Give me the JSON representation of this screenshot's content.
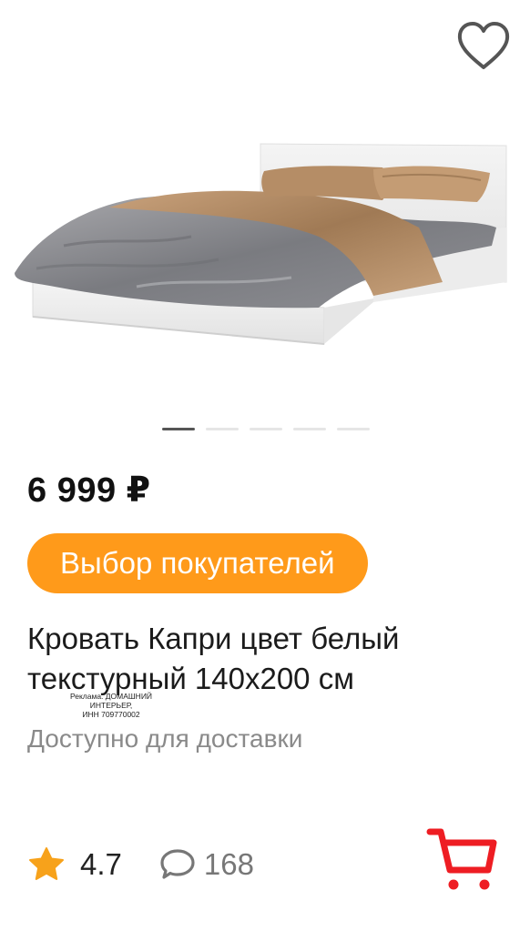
{
  "product": {
    "price": "6 999 ₽",
    "badge": "Выбор покупателей",
    "title": "Кровать Капри цвет белый текстурный 140х200 см",
    "ad_line1": "Реклама. ДОМАШНИЙ ИНТЕРЬЕР,",
    "ad_line2": "ИНН 709770002",
    "availability": "Доступно для доставки",
    "rating": "4.7",
    "reviews": "168"
  },
  "carousel": {
    "total": 5,
    "active": 1
  },
  "colors": {
    "accent": "#ff9a1a",
    "cart": "#ee1d23",
    "star": "#f7a21b",
    "muted": "#8a8a8a"
  },
  "icons": {
    "favorite": "heart-outline-icon",
    "rating": "star-icon",
    "reviews": "comment-icon",
    "cart": "shopping-cart-icon"
  }
}
